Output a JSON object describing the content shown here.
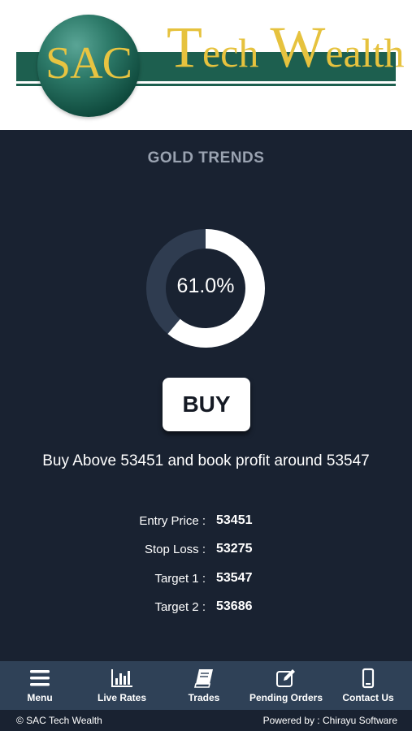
{
  "header": {
    "logo_sac": "SAC",
    "logo_rest_1": "T",
    "logo_rest_2": "ech",
    "logo_rest_3": "W",
    "logo_rest_4": "ealth",
    "colors": {
      "band": "#1d5f4f",
      "gold": "#e6c23e"
    }
  },
  "page": {
    "title": "GOLD TRENDS"
  },
  "gauge": {
    "percent_label": "61.0%",
    "fraction": 0.61,
    "fill_color": "#ffffff",
    "track_color": "#2f3c50"
  },
  "signal": {
    "button_label": "BUY",
    "advice": "Buy Above 53451 and book profit around 53547"
  },
  "details": [
    {
      "label": "Entry Price :",
      "value": "53451"
    },
    {
      "label": "Stop Loss :",
      "value": "53275"
    },
    {
      "label": "Target 1 :",
      "value": "53547"
    },
    {
      "label": "Target 2 :",
      "value": "53686"
    }
  ],
  "nav": [
    {
      "label": "Menu",
      "icon": "menu-icon"
    },
    {
      "label": "Live Rates",
      "icon": "bar-chart-icon"
    },
    {
      "label": "Trades",
      "icon": "book-icon"
    },
    {
      "label": "Pending Orders",
      "icon": "edit-icon"
    },
    {
      "label": "Contact Us",
      "icon": "phone-icon"
    }
  ],
  "footer": {
    "copyright": "© SAC Tech Wealth",
    "powered": "Powered by : Chirayu Software"
  }
}
